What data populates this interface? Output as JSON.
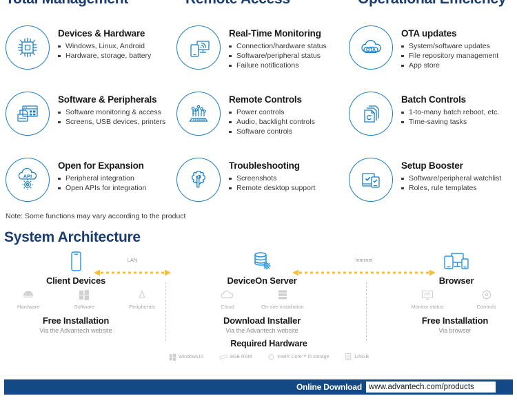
{
  "columns": [
    {
      "heading": "Total Management",
      "items": [
        {
          "icon": "chip-icon",
          "title": "Devices & Hardware",
          "bullets": [
            "Windows, Linux, Android",
            "Hardware, storage, battery"
          ]
        },
        {
          "icon": "software-peripherals-icon",
          "title": "Software & Peripherals",
          "bullets": [
            "Software monitoring & access",
            "Screens, USB devices, printers"
          ]
        },
        {
          "icon": "api-cloud-gear-icon",
          "title": "Open for Expansion",
          "bullets": [
            "Peripheral integration",
            "Open APIs for integration"
          ]
        }
      ]
    },
    {
      "heading": "Remote Access",
      "items": [
        {
          "icon": "devices-signal-icon",
          "title": "Real-Time Monitoring",
          "bullets": [
            "Connection/hardware status",
            "Software/peripheral status",
            "Failure notifications"
          ]
        },
        {
          "icon": "circuit-controls-icon",
          "title": "Remote Controls",
          "bullets": [
            "Power controls",
            "Audio, backlight controls",
            "Software controls"
          ]
        },
        {
          "icon": "gear-wrench-icon",
          "title": "Troubleshooting",
          "bullets": [
            "Screenshots",
            "Remote desktop support"
          ]
        }
      ]
    },
    {
      "heading": "Operational Efficiency",
      "items": [
        {
          "icon": "ota-cloud-icon",
          "title": "OTA updates",
          "bullets": [
            "System/software updates",
            "File repository management",
            "App store"
          ]
        },
        {
          "icon": "stacked-pages-refresh-icon",
          "title": "Batch Controls",
          "bullets": [
            "1-to-many batch reboot, etc.",
            "Time-saving tasks"
          ]
        },
        {
          "icon": "checklist-devices-icon",
          "title": "Setup Booster",
          "bullets": [
            "Software/peripheral watchlist",
            "Roles, rule templates"
          ]
        }
      ]
    }
  ],
  "note": "Note: Some functions may vary according to the product",
  "architecture": {
    "title": "System Architecture",
    "links": [
      {
        "label": "LAN"
      },
      {
        "label": "Internet"
      }
    ],
    "nodes": [
      {
        "icon": "mobile-device-icon",
        "name": "Client Devices",
        "sub": [
          {
            "icon": "android-icon",
            "label": "Hardware"
          },
          {
            "icon": "windows-icon",
            "label": "Software"
          },
          {
            "icon": "peripherals-icon",
            "label": "Peripherals"
          }
        ],
        "install_title": "Free Installation",
        "install_sub": "Via the Advantech website"
      },
      {
        "icon": "database-gear-icon",
        "name": "DeviceOn Server",
        "sub": [
          {
            "icon": "cloud-icon",
            "label": "Cloud"
          },
          {
            "icon": "server-rack-icon",
            "label": "On-site installation"
          }
        ],
        "install_title": "Download Installer",
        "install_sub": "Via the Advantech website"
      },
      {
        "icon": "browser-devices-icon",
        "name": "Browser",
        "sub": [
          {
            "icon": "monitor-status-icon",
            "label": "Monitor status"
          },
          {
            "icon": "controls-gear-icon",
            "label": "Controls"
          }
        ],
        "install_title": "Free Installation",
        "install_sub": "Via browser"
      }
    ],
    "required_hardware": {
      "title": "Required Hardware",
      "specs": [
        {
          "icon": "windows-icon",
          "label": "Windows10"
        },
        {
          "icon": "ram-icon",
          "label": "8GB RAM"
        },
        {
          "icon": "cpu-icon",
          "label": "Intel® Core™ i5 storage"
        },
        {
          "icon": "storage-icon",
          "label": "125GB"
        }
      ]
    }
  },
  "footer": {
    "label": "Online Download",
    "url": "www.advantech.com/products"
  },
  "colors": {
    "heading_navy": "#1a3c6e",
    "icon_blue": "#1b7fc4",
    "arrow_yellow": "#f5c032",
    "footer_navy": "#134a86"
  }
}
